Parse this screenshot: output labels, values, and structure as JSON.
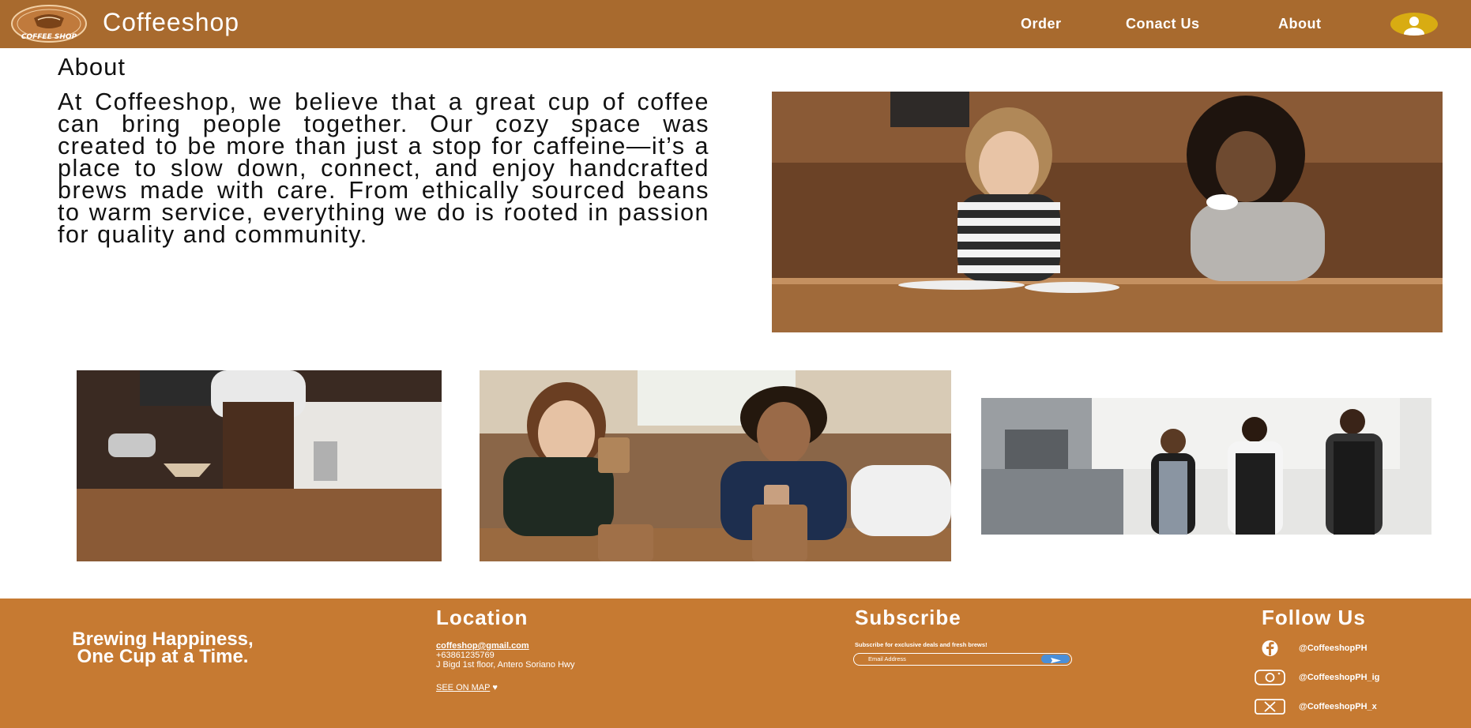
{
  "header": {
    "logo_text": "COFFEE SHOP",
    "brand": "Coffeeshop",
    "nav": [
      {
        "label": "Order"
      },
      {
        "label": "Conact Us"
      },
      {
        "label": "About"
      }
    ],
    "bar_color": "#a86a2e",
    "avatar_color": "#d8ac12",
    "avatar_icon": "user-avatar-icon"
  },
  "about": {
    "title": "About",
    "body": "At Coffeeshop, we believe that a great cup of coffee can bring people together. Our cozy space was created to be more than just a stop for caffeine—it’s a place to slow down, connect, and enjoy handcrafted brews made with care. From ethically sourced beans to warm service, everything we do is rooted in passion for quality and community."
  },
  "photos": [
    {
      "name": "two-women-coffee-photo"
    },
    {
      "name": "barista-pour-over-photo"
    },
    {
      "name": "friends-laughing-coffee-photo"
    },
    {
      "name": "baristas-team-photo"
    }
  ],
  "footer": {
    "bg_color": "#c67a32",
    "tagline": "Brewing Happiness, One Cup at a Time.",
    "location": {
      "heading": "Location",
      "email": "coffeshop@gmail.com",
      "phone": "+63861235769",
      "address": "J Bigd 1st floor, Antero Soriano Hwy",
      "map_link": "SEE ON MAP"
    },
    "subscribe": {
      "heading": "Subscribe",
      "note": "Subscribe for exclusive deals and fresh brews!",
      "placeholder": "Email Address",
      "button_icon": "send-icon"
    },
    "follow": {
      "heading": "Follow Us",
      "items": [
        {
          "icon": "facebook-icon",
          "handle": "@CoffeeshopPH"
        },
        {
          "icon": "instagram-icon",
          "handle": "@CoffeeshopPH_ig"
        },
        {
          "icon": "x-icon",
          "handle": "@CoffeeshopPH_x"
        }
      ]
    }
  }
}
